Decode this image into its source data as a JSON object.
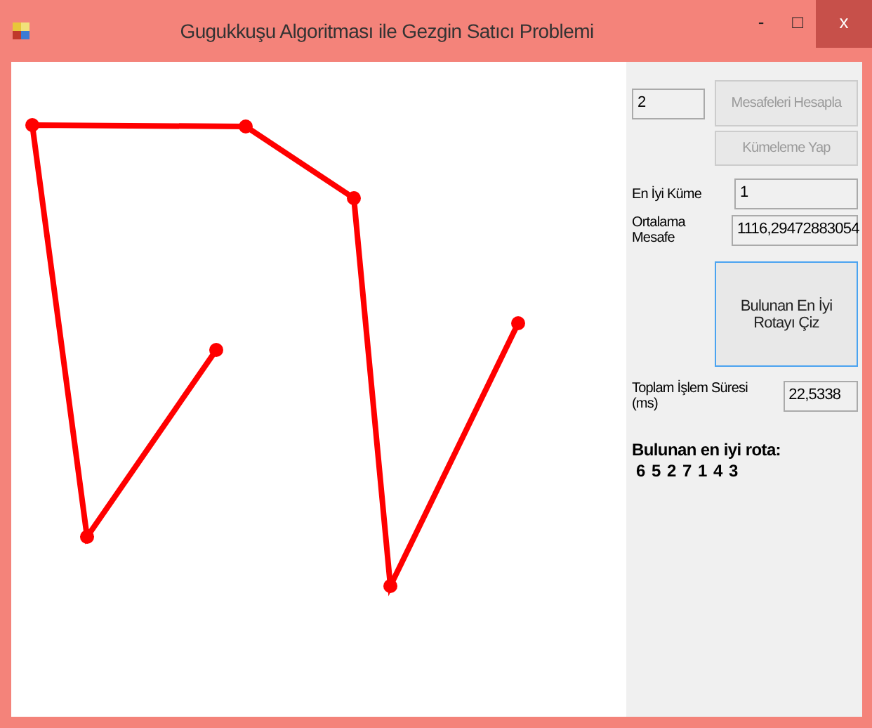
{
  "window": {
    "title": "Gugukkuşu Algoritması ile Gezgin Satıcı Problemi",
    "controls": [
      "-",
      "□",
      "x"
    ]
  },
  "cluster_count": {
    "value": "2"
  },
  "buttons": [
    {
      "label": "Mesafeleri Hesapla",
      "disabled": true
    },
    {
      "label": "Kümeleme Yap",
      "disabled": true
    }
  ],
  "best_cluster": {
    "label": "En İyi Küme",
    "value": "1"
  },
  "average_distance": {
    "label": "Ortalama Mesafe",
    "value": "1116,29472883054"
  },
  "draw_button": {
    "label": "Bulunan En İyi Rotayı Çiz",
    "disabled": false,
    "focused": true
  },
  "total_time": {
    "label": "Toplam İşlem Süresi (ms)",
    "value": "22,5338"
  },
  "result": {
    "heading": "Bulunan en iyi rota:",
    "route": "6 5 2 7 1 4 3"
  }
}
